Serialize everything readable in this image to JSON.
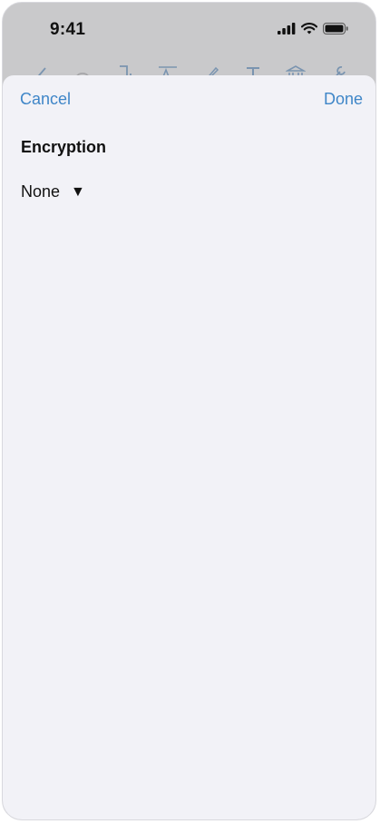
{
  "status_bar": {
    "time": "9:41",
    "icons": [
      "cellular-signal-icon",
      "wifi-icon",
      "battery-icon"
    ]
  },
  "toolbar": {
    "icons": [
      "back-icon",
      "undo-icon",
      "page-icon",
      "text-style-icon",
      "pen-icon",
      "text-icon",
      "bank-icon",
      "wrench-icon"
    ]
  },
  "nav": {
    "cancel_label": "Cancel",
    "done_label": "Done"
  },
  "encryption": {
    "title": "Encryption",
    "selected_value": "None",
    "caret": "▼"
  },
  "colors": {
    "accent": "#3f86c8",
    "sheet_background": "#f2f2f7",
    "dimmed_background": "#c9c9cb"
  }
}
